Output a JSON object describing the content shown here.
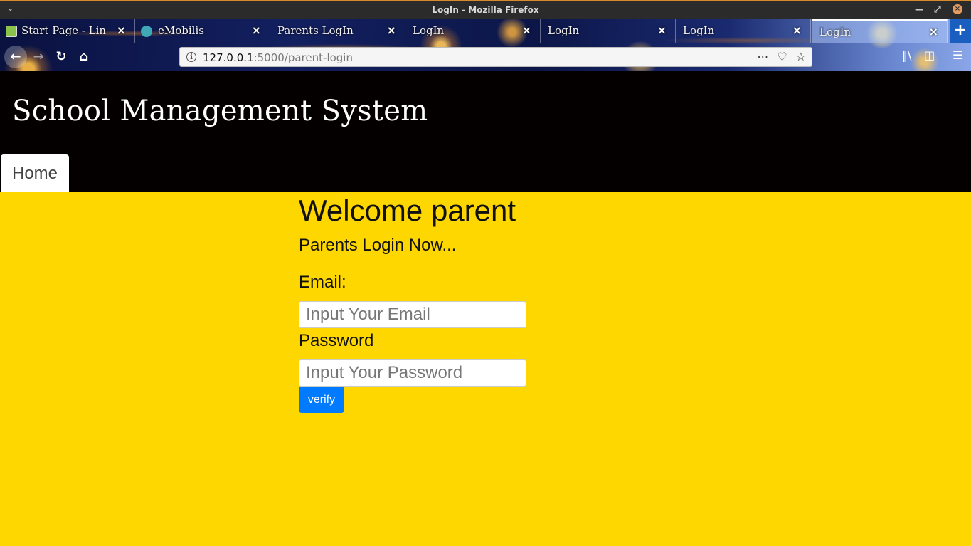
{
  "window": {
    "title": "LogIn - Mozilla Firefox"
  },
  "browser": {
    "tabs": [
      {
        "label": "Start Page - Lin",
        "active": false,
        "favicon": "page-icon"
      },
      {
        "label": "eMobilis",
        "active": false,
        "favicon": "globe-icon"
      },
      {
        "label": "Parents LogIn",
        "active": false,
        "favicon": ""
      },
      {
        "label": "LogIn",
        "active": false,
        "favicon": ""
      },
      {
        "label": "LogIn",
        "active": false,
        "favicon": ""
      },
      {
        "label": "LogIn",
        "active": false,
        "favicon": ""
      },
      {
        "label": "LogIn",
        "active": true,
        "favicon": ""
      }
    ],
    "url_host": "127.0.0.1",
    "url_rest": ":5000/parent-login"
  },
  "site": {
    "title": "School Management System",
    "nav_home": "Home"
  },
  "login": {
    "heading": "Welcome parent",
    "subtitle": "Parents Login Now...",
    "email_label": "Email:",
    "email_placeholder": "Input Your Email",
    "password_label": "Password",
    "password_placeholder": "Input Your Password",
    "submit_label": "verify"
  },
  "colors": {
    "page_background": "#ffd700",
    "header_background": "#040000",
    "button": "#007bff"
  }
}
